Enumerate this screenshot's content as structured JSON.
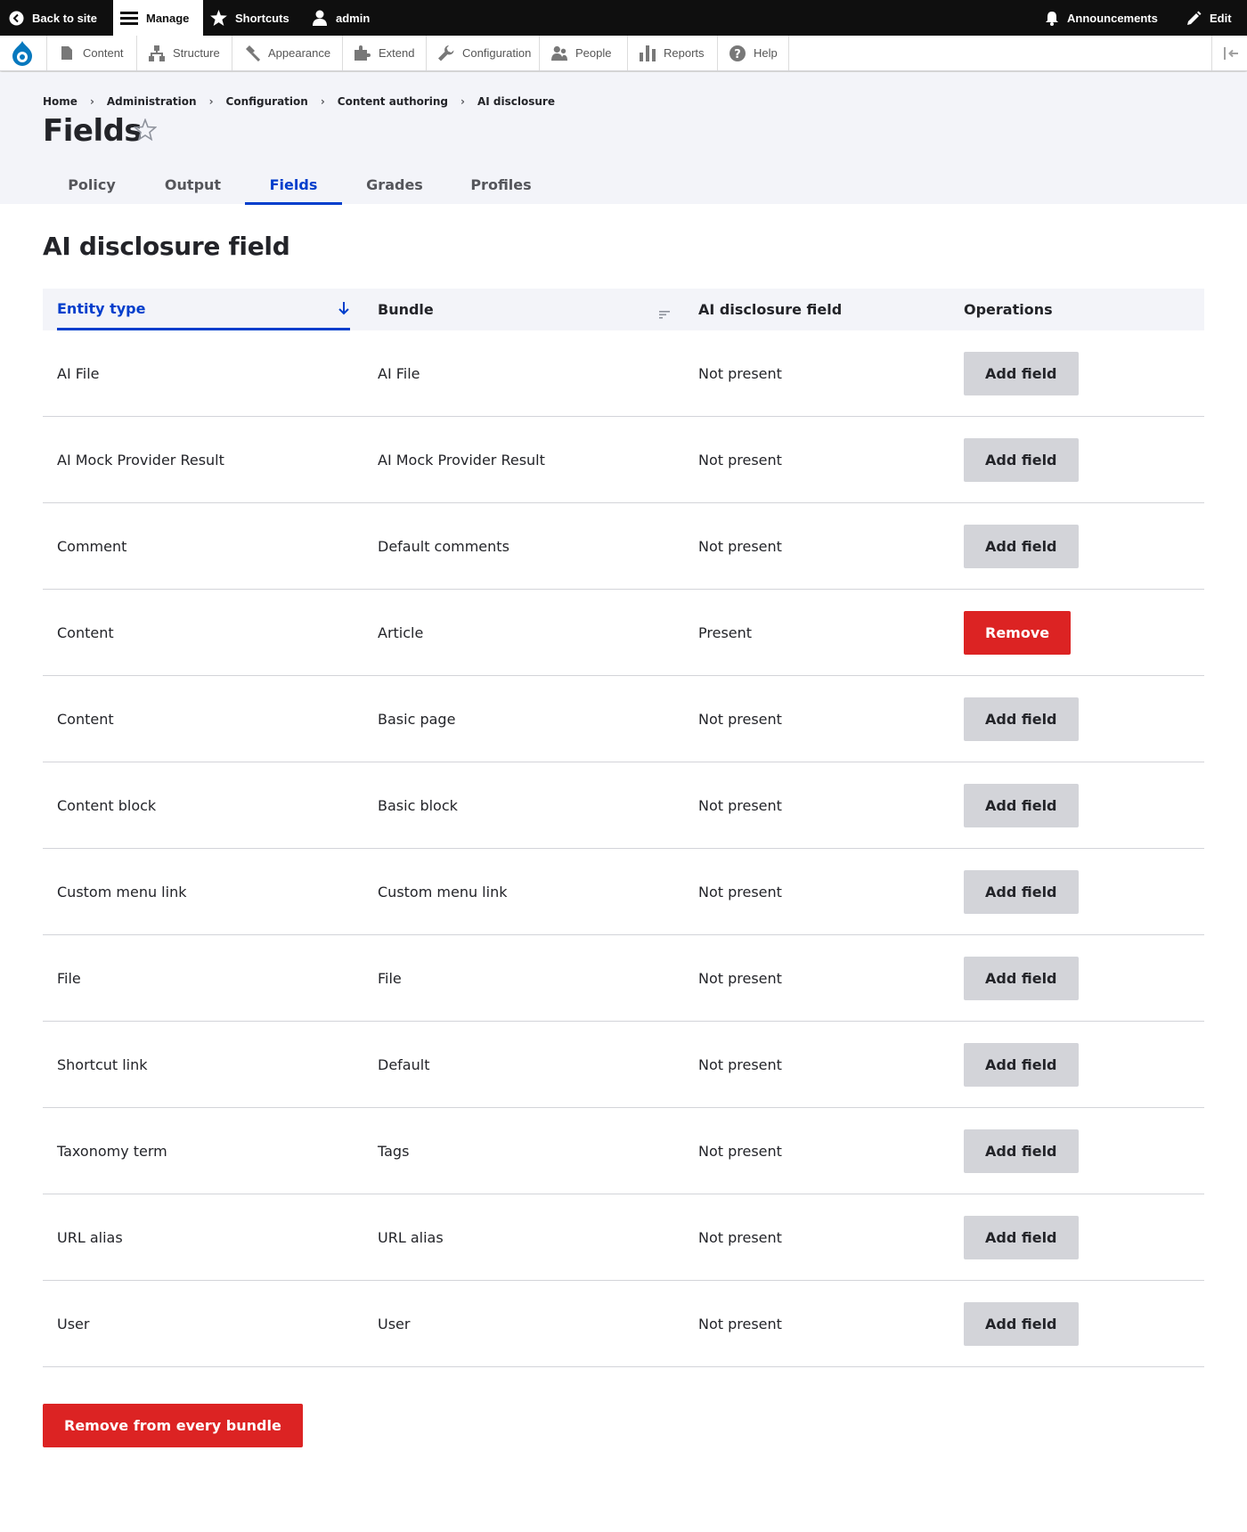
{
  "toolbar": {
    "back_to_site": "Back to site",
    "manage": "Manage",
    "shortcuts": "Shortcuts",
    "user": "admin",
    "announcements": "Announcements",
    "edit": "Edit"
  },
  "tray": {
    "items": [
      {
        "label": "Content",
        "icon": "content-icon"
      },
      {
        "label": "Structure",
        "icon": "structure-icon"
      },
      {
        "label": "Appearance",
        "icon": "appearance-icon"
      },
      {
        "label": "Extend",
        "icon": "extend-icon"
      },
      {
        "label": "Configuration",
        "icon": "configuration-icon"
      },
      {
        "label": "People",
        "icon": "people-icon"
      },
      {
        "label": "Reports",
        "icon": "reports-icon"
      },
      {
        "label": "Help",
        "icon": "help-icon"
      }
    ]
  },
  "breadcrumb": [
    "Home",
    "Administration",
    "Configuration",
    "Content authoring",
    "AI disclosure"
  ],
  "page_title": "Fields",
  "tabs": [
    {
      "label": "Policy"
    },
    {
      "label": "Output"
    },
    {
      "label": "Fields",
      "active": true
    },
    {
      "label": "Grades"
    },
    {
      "label": "Profiles"
    }
  ],
  "section_title": "AI disclosure field",
  "table": {
    "headers": {
      "entity_type": "Entity type",
      "bundle": "Bundle",
      "field": "AI disclosure field",
      "operations": "Operations"
    },
    "rows": [
      {
        "entity_type": "AI File",
        "bundle": "AI File",
        "status": "Not present",
        "action": "Add field"
      },
      {
        "entity_type": "AI Mock Provider Result",
        "bundle": "AI Mock Provider Result",
        "status": "Not present",
        "action": "Add field"
      },
      {
        "entity_type": "Comment",
        "bundle": "Default comments",
        "status": "Not present",
        "action": "Add field"
      },
      {
        "entity_type": "Content",
        "bundle": "Article",
        "status": "Present",
        "action": "Remove"
      },
      {
        "entity_type": "Content",
        "bundle": "Basic page",
        "status": "Not present",
        "action": "Add field"
      },
      {
        "entity_type": "Content block",
        "bundle": "Basic block",
        "status": "Not present",
        "action": "Add field"
      },
      {
        "entity_type": "Custom menu link",
        "bundle": "Custom menu link",
        "status": "Not present",
        "action": "Add field"
      },
      {
        "entity_type": "File",
        "bundle": "File",
        "status": "Not present",
        "action": "Add field"
      },
      {
        "entity_type": "Shortcut link",
        "bundle": "Default",
        "status": "Not present",
        "action": "Add field"
      },
      {
        "entity_type": "Taxonomy term",
        "bundle": "Tags",
        "status": "Not present",
        "action": "Add field"
      },
      {
        "entity_type": "URL alias",
        "bundle": "URL alias",
        "status": "Not present",
        "action": "Add field"
      },
      {
        "entity_type": "User",
        "bundle": "User",
        "status": "Not present",
        "action": "Add field"
      }
    ]
  },
  "remove_all_label": "Remove from every bundle",
  "colors": {
    "accent": "#003ecc",
    "danger": "#dc2323",
    "secondary_button": "#d3d4d9",
    "toolbar": "#0f0f0f",
    "header_bg": "#f3f4f9"
  }
}
